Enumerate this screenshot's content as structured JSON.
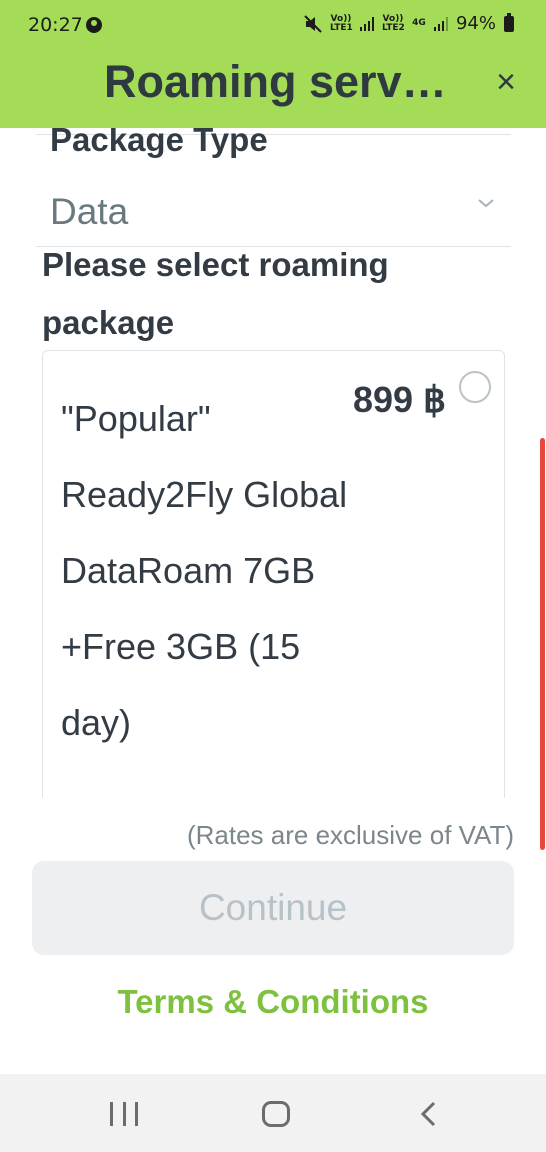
{
  "status_bar": {
    "time": "20:27",
    "network_1": "Vo)) LTE1",
    "network_2": "Vo)) LTE2",
    "network_type": "4G",
    "battery": "94%"
  },
  "header": {
    "title": "Roaming servic…",
    "close_icon": "×"
  },
  "package_type": {
    "label": "Package Type",
    "value": "Data"
  },
  "select_label": "Please select roaming package",
  "package": {
    "name": "\"Popular\" Ready2Fly Global DataRoam 7GB +Free 3GB (15 day)",
    "price": "899 ฿"
  },
  "vat_note": "(Rates are exclusive of VAT)",
  "continue_label": "Continue",
  "terms_label": "Terms & Conditions",
  "colors": {
    "header_bg": "#a4dc58",
    "link": "#7ec13f",
    "scroll_indicator": "#e44a3b"
  }
}
